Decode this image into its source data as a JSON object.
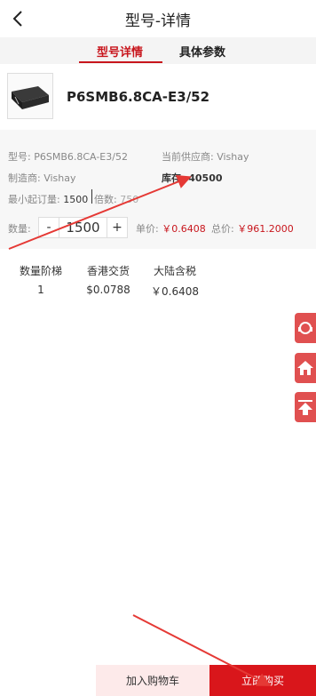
{
  "header": {
    "title": "型号-详情"
  },
  "tabs": [
    {
      "label": "型号详情"
    },
    {
      "label": "具体参数"
    }
  ],
  "product": {
    "name": "P6SMB6.8CA-E3/52"
  },
  "info": {
    "model_label": "型号:",
    "model_value": "P6SMB6.8CA-E3/52",
    "supplier_label": "当前供应商:",
    "supplier_value": "Vishay",
    "manufacturer_label": "制造商:",
    "manufacturer_value": "Vishay",
    "stock_label": "库存:",
    "stock_value": "40500",
    "moq_label": "最小起订量:",
    "moq_value": "1500",
    "multiple_label": "倍数:",
    "multiple_value": "750",
    "qty_label": "数量:",
    "qty_minus": "-",
    "qty_value": "1500",
    "qty_plus": "+",
    "unit_price_label": "单价:",
    "unit_price_value": "￥0.6408",
    "total_label": "总价:",
    "total_value": "￥961.2000"
  },
  "price_table": {
    "headers": [
      "数量阶梯",
      "香港交货",
      "大陆含税"
    ],
    "rows": [
      [
        "1",
        "$0.0788",
        "￥0.6408"
      ]
    ]
  },
  "bottom": {
    "add_cart": "加入购物车",
    "buy_now": "立即购买"
  },
  "colors": {
    "accent": "#c8161d",
    "buy_bg": "#d9161b",
    "cart_bg": "#fdeaea"
  },
  "icons": [
    "back-arrow-icon",
    "customer-service-icon",
    "home-icon",
    "back-to-top-icon"
  ]
}
